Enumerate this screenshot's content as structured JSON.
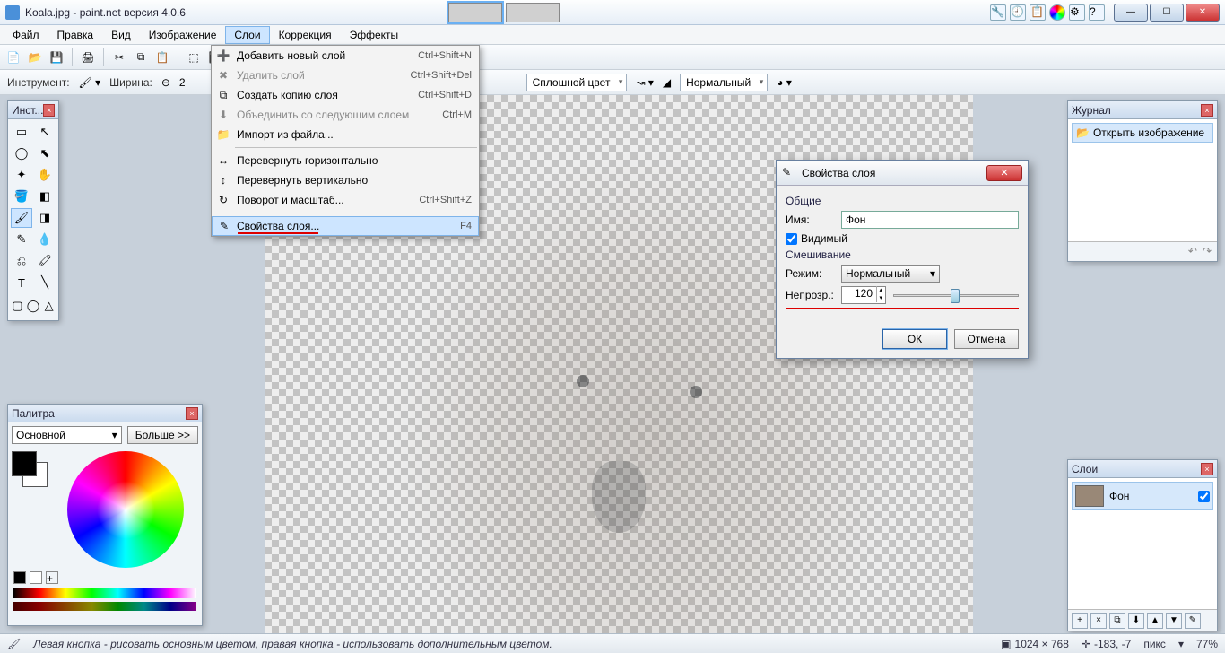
{
  "title": "Koala.jpg - paint.net версия 4.0.6",
  "menubar": [
    "Файл",
    "Правка",
    "Вид",
    "Изображение",
    "Слои",
    "Коррекция",
    "Эффекты"
  ],
  "menubar_open_index": 4,
  "toolbar2": {
    "tool_label": "Инструмент:",
    "width_label": "Ширина:",
    "width_value": "2",
    "fill_label": "Сплошной цвет",
    "blend_label": "Нормальный"
  },
  "dropdown": [
    {
      "icon": "➕",
      "label": "Добавить новый слой",
      "sc": "Ctrl+Shift+N"
    },
    {
      "icon": "✖",
      "label": "Удалить слой",
      "sc": "Ctrl+Shift+Del",
      "disabled": true
    },
    {
      "icon": "⧉",
      "label": "Создать копию слоя",
      "sc": "Ctrl+Shift+D"
    },
    {
      "icon": "⬇",
      "label": "Объединить со следующим слоем",
      "sc": "Ctrl+M",
      "disabled": true
    },
    {
      "icon": "📁",
      "label": "Импорт из файла...",
      "sc": ""
    },
    {
      "sep": true
    },
    {
      "icon": "↔",
      "label": "Перевернуть горизонтально",
      "sc": ""
    },
    {
      "icon": "↕",
      "label": "Перевернуть вертикально",
      "sc": ""
    },
    {
      "icon": "↻",
      "label": "Поворот и масштаб...",
      "sc": "Ctrl+Shift+Z"
    },
    {
      "sep": true
    },
    {
      "icon": "✎",
      "label": "Свойства слоя...",
      "sc": "F4",
      "hl": true,
      "redline": true
    }
  ],
  "dialog": {
    "title": "Свойства слоя",
    "section_general": "Общие",
    "name_label": "Имя:",
    "name_value": "Фон",
    "visible_label": "Видимый",
    "visible_checked": true,
    "section_blend": "Смешивание",
    "mode_label": "Режим:",
    "mode_value": "Нормальный",
    "opacity_label": "Непрозр.:",
    "opacity_value": "120",
    "ok": "ОК",
    "cancel": "Отмена"
  },
  "tools_panel_title": "Инст...",
  "history_panel": {
    "title": "Журнал",
    "item": "Открыть изображение"
  },
  "layers_panel": {
    "title": "Слои",
    "layer_name": "Фон"
  },
  "palette_panel": {
    "title": "Палитра",
    "mode": "Основной",
    "more": "Больше >>"
  },
  "statusbar": {
    "hint": "Левая кнопка - рисовать основным цветом, правая кнопка - использовать дополнительным цветом.",
    "dims": "1024 × 768",
    "coords": "-183, -7",
    "units": "пикс",
    "zoom": "77%"
  }
}
